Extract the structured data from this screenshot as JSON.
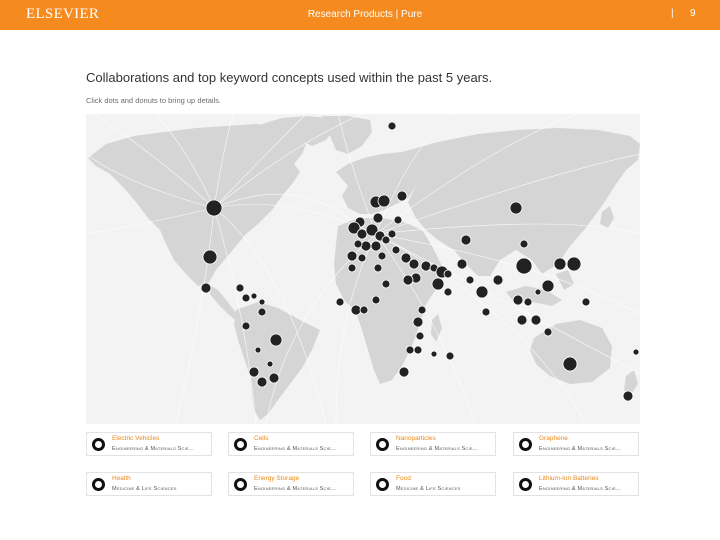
{
  "header": {
    "logo": "ELSEVIER",
    "title": "Research Products | Pure",
    "separator": "|",
    "page_number": "9"
  },
  "content": {
    "title": "Collaborations and top keyword concepts used within the past 5 years.",
    "subtitle": "Click dots and donuts to bring up details."
  },
  "concepts": [
    {
      "name": "Electric Vehicles",
      "category": "Engineering & Materials Scie..."
    },
    {
      "name": "Cells",
      "category": "Engineering & Materials Scie..."
    },
    {
      "name": "Nanoparticles",
      "category": "Engineering & Materials Scie..."
    },
    {
      "name": "Graphene",
      "category": "Engineering & Materials Scie..."
    },
    {
      "name": "Health",
      "category": "Medicine & Life Sciences"
    },
    {
      "name": "Energy Storage",
      "category": "Engineering & Materials Scie..."
    },
    {
      "name": "Food",
      "category": "Medicine & Life Sciences"
    },
    {
      "name": "Lithium-Ion Batteries",
      "category": "Engineering & Materials Scie..."
    }
  ],
  "colors": {
    "header_bg": "#f58b1f",
    "accent": "#e88a1c",
    "dot": "#222222",
    "land": "#d6d6d6"
  }
}
